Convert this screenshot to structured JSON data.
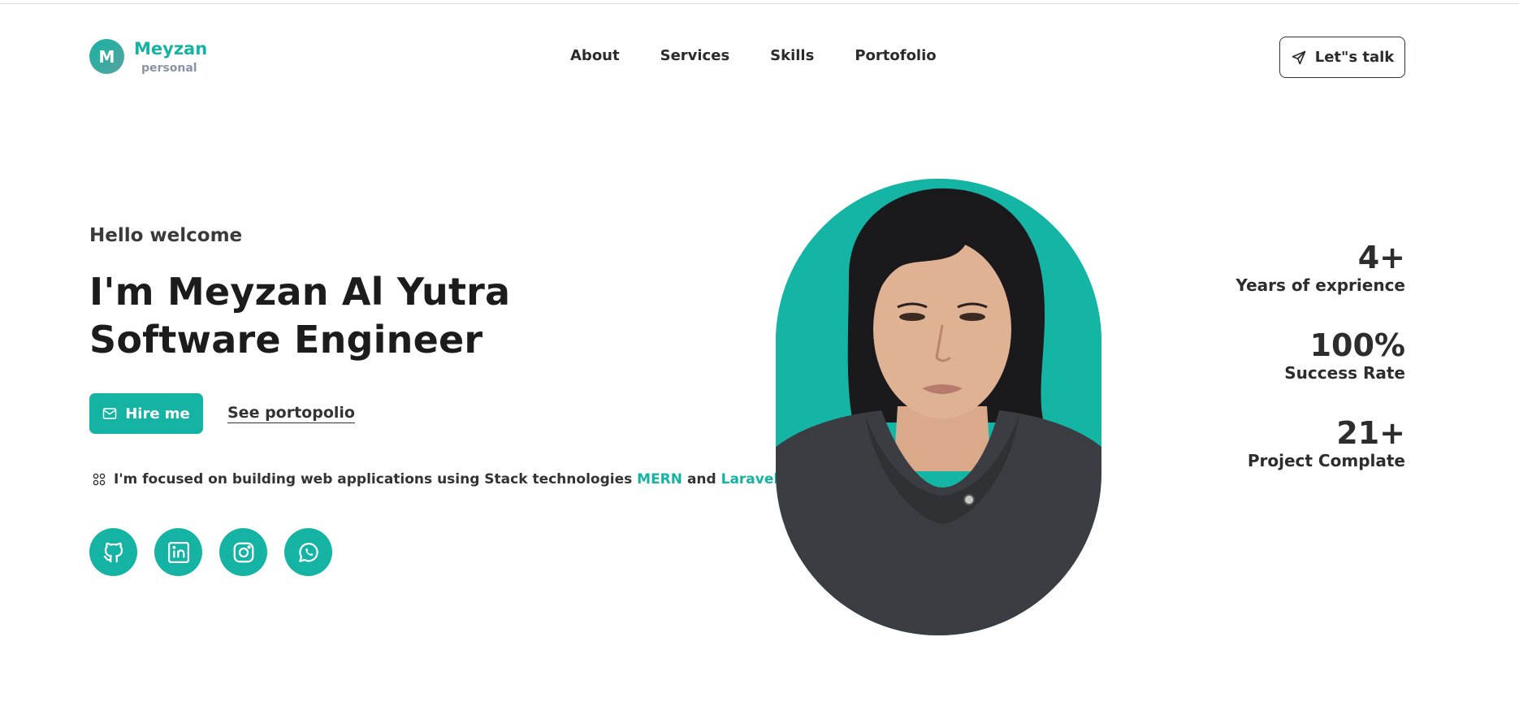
{
  "brand": {
    "initial": "M",
    "name": "Meyzan",
    "subtitle": "personal"
  },
  "nav": {
    "items": [
      "About",
      "Services",
      "Skills",
      "Portofolio"
    ]
  },
  "cta": {
    "label": "Let\"s talk",
    "icon": "send-icon"
  },
  "hero": {
    "greeting": "Hello welcome",
    "title_line1": "I'm Meyzan Al Yutra",
    "title_line2": "Software Engineer",
    "hire_label": "Hire me",
    "portfolio_link": "See portopolio",
    "focus_text": "I'm focused on building web applications using Stack technologies",
    "focus_tech1": "MERN",
    "focus_and": "and",
    "focus_tech2": "Laravel"
  },
  "socials": [
    {
      "icon": "github-icon"
    },
    {
      "icon": "linkedin-icon"
    },
    {
      "icon": "instagram-icon"
    },
    {
      "icon": "whatsapp-icon"
    }
  ],
  "stats": [
    {
      "value": "4+",
      "label": "Years of exprience"
    },
    {
      "value": "100%",
      "label": "Success Rate"
    },
    {
      "value": "21+",
      "label": "Project Complate"
    }
  ],
  "colors": {
    "accent": "#14b3a3",
    "text": "#1c1c1c",
    "muted": "#8a94a6"
  }
}
